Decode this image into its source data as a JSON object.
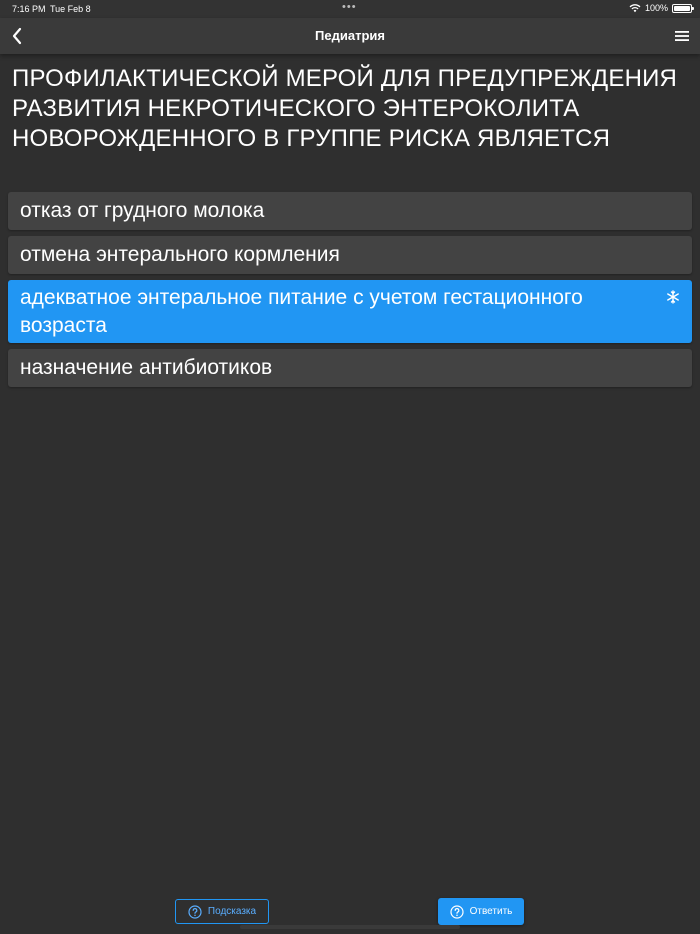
{
  "status_bar": {
    "time": "7:16 PM",
    "date": "Tue Feb 8",
    "battery": "100%",
    "battery_level": 1.0
  },
  "nav": {
    "title": "Педиатрия",
    "back_icon": "chevron-left-icon",
    "menu_icon": "hamburger-menu-icon"
  },
  "question": {
    "text": "ПРОФИЛАКТИЧЕСКОЙ МЕРОЙ ДЛЯ ПРЕДУПРЕЖДЕНИЯ РАЗВИТИЯ НЕКРОТИЧЕСКОГО ЭНТЕРОКОЛИТА НОВОРОЖДЕННОГО В ГРУППЕ РИСКА ЯВЛЯЕТСЯ"
  },
  "answers": [
    {
      "label": "отказ от грудного молока",
      "selected": false
    },
    {
      "label": "отмена энтерального кормления",
      "selected": false
    },
    {
      "label": "адекватное энтеральное питание с учетом гестационного возраста",
      "selected": true
    },
    {
      "label": "назначение антибиотиков",
      "selected": false
    }
  ],
  "buttons": {
    "hint_label": "Подсказка",
    "answer_label": "Ответить"
  },
  "colors": {
    "background": "#2f2f2f",
    "nav_background": "#3a3a3a",
    "option_background": "#434343",
    "accent": "#2196f3"
  }
}
